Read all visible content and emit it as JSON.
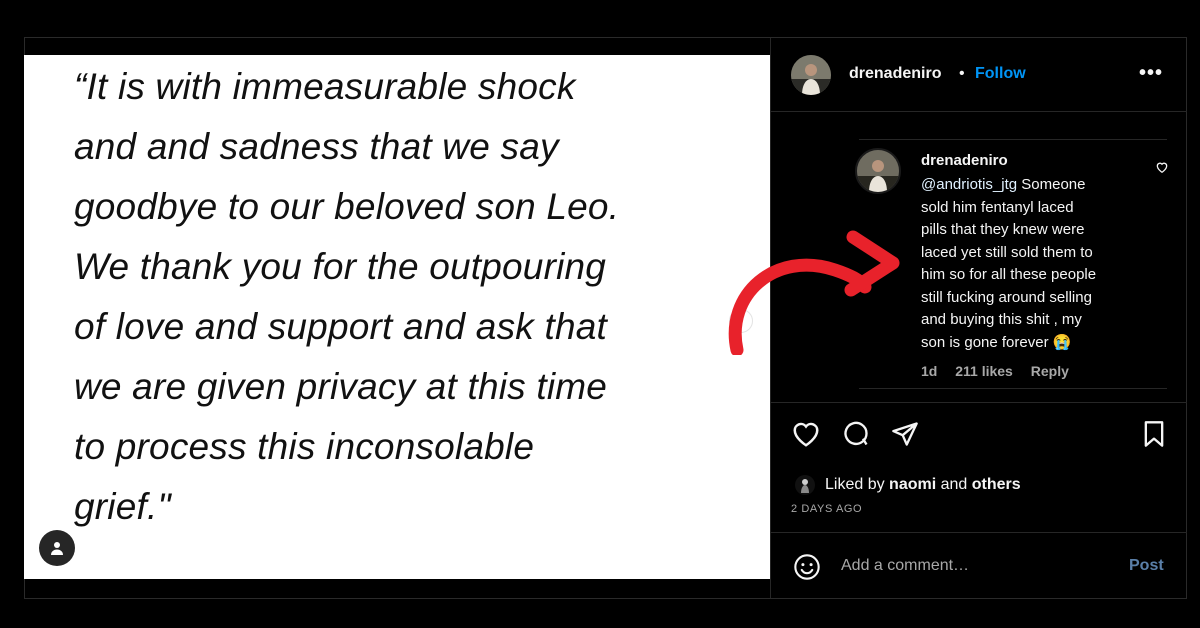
{
  "post_media": {
    "quote_lines": [
      "“It is with immeasurable shock",
      "and and sadness that we say",
      "goodbye to our beloved son Leo.",
      "We thank you for the outpouring",
      "of love and support and ask that",
      "we are given privacy at this time",
      "to process this inconsolable",
      "grief.\""
    ],
    "tag_icon": "user-tag-icon"
  },
  "header": {
    "username": "drenadeniro",
    "separator": "•",
    "follow_label": "Follow",
    "more_label": "•••"
  },
  "comment": {
    "username": "drenadeniro",
    "mention": "@andriotis_jtg",
    "lines": [
      " Someone",
      "sold him fentanyl laced",
      "pills that they knew were",
      "laced yet still sold them to",
      "him so for all these people",
      "still fucking around selling",
      "and buying this shit , my",
      "son is gone forever 😭"
    ],
    "time": "1d",
    "likes": "211 likes",
    "reply_label": "Reply"
  },
  "actions": {
    "icons": [
      "heart-icon",
      "comment-icon",
      "share-icon",
      "bookmark-icon"
    ]
  },
  "likes": {
    "prefix": "Liked by ",
    "user": "naomi",
    "middle": " and ",
    "others": "others",
    "time_ago": "2 DAYS AGO"
  },
  "composer": {
    "placeholder": "Add a comment…",
    "post_label": "Post"
  },
  "colors": {
    "background": "#000000",
    "link_blue": "#0095f6",
    "arrow_red": "#e8222b",
    "muted_text": "#a8a8a8"
  }
}
